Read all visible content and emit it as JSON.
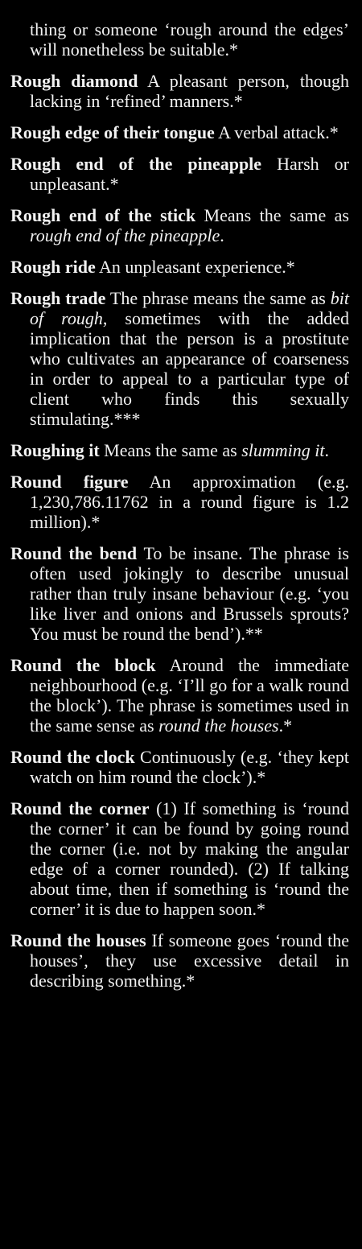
{
  "entries": [
    {
      "term": "",
      "parts": [
        "thing or someone ‘rough around the edges’ will nonetheless be suitable.*"
      ]
    },
    {
      "term": "Rough diamond",
      "parts": [
        " A pleasant person, though lacking in ‘refined’ manners.*"
      ]
    },
    {
      "term": "Rough edge of their tongue",
      "parts": [
        " A verbal attack.*"
      ]
    },
    {
      "term": "Rough end of the pineapple",
      "parts": [
        " Harsh or unpleasant.*"
      ]
    },
    {
      "term": "Rough end of the stick",
      "parts": [
        " Means the same as ",
        "rough end of the pineapple",
        "."
      ]
    },
    {
      "term": "Rough ride",
      "parts": [
        " An unpleasant experience.*"
      ]
    },
    {
      "term": "Rough trade",
      "parts": [
        " The phrase means the same as ",
        "bit of rough",
        ", sometimes with the added implication that the person is a prostitute who cultivates an appearance of coarseness in order to appeal to a particular type of client who finds this sexually stimulating.***"
      ]
    },
    {
      "term": "Roughing it",
      "parts": [
        " Means the same as ",
        "slumming it",
        "."
      ]
    },
    {
      "term": "Round figure",
      "parts": [
        " An approximation (e.g. 1,230,786.11762 in a round figure is 1.2 million).*"
      ]
    },
    {
      "term": "Round the bend",
      "parts": [
        " To be insane. The phrase is often used jokingly to describe unusual rather than truly insane behaviour (e.g. ‘you like liver and onions and Brussels sprouts? You must be round the bend’).**"
      ]
    },
    {
      "term": "Round the block",
      "parts": [
        " Around the immediate neighbourhood (e.g. ‘I’ll go for a walk round the block’). The phrase is sometimes used in the same sense as ",
        "round the houses",
        ".*"
      ]
    },
    {
      "term": "Round the clock",
      "parts": [
        " Continuously (e.g. ‘they kept watch on him round the clock’).*"
      ]
    },
    {
      "term": "Round the corner",
      "parts": [
        " (1) If something is ‘round the corner’ it can be found by going round the corner (i.e. not by making the angular edge of a corner rounded). (2) If talking about time, then if something is ‘round the corner’ it is due to happen soon.*"
      ]
    },
    {
      "term": "Round the houses",
      "parts": [
        " If someone goes ‘round the houses’, they use excessive detail in describing something.*"
      ]
    }
  ]
}
